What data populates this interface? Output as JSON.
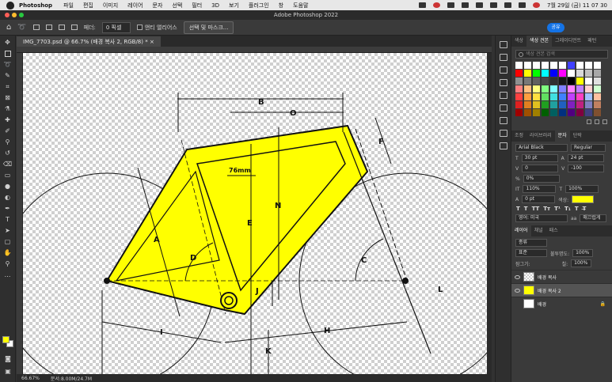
{
  "menubar": {
    "app_name": "Photoshop",
    "items": [
      "파일",
      "편집",
      "이미지",
      "레이어",
      "문자",
      "선택",
      "필터",
      "3D",
      "보기",
      "플러그인",
      "창",
      "도움말"
    ],
    "datetime": "7월 29일 (금) 11 07 30"
  },
  "window": {
    "title": "Adobe Photoshop 2022"
  },
  "options_bar": {
    "feather_label": "페더:",
    "feather_value": "0 픽셀",
    "antialias_label": "앤티 앨리어스",
    "select_mask_label": "선택 및 마스크...",
    "share_label": "공유"
  },
  "document": {
    "tab_title": "IMG_7703.psd @ 66.7% (배경 복사 2, RGB/8) *"
  },
  "status": {
    "zoom": "66.67%",
    "doc_info": "문서:8.00M/24.7M"
  },
  "swatches_panel": {
    "tabs": [
      "색상",
      "색상 견본",
      "그레이디언트",
      "패턴"
    ],
    "active_tab": "색상 견본",
    "search_placeholder": "색상 견본 검색",
    "colors": [
      "#ffffff",
      "#ffffff",
      "#ffffff",
      "#ffffff",
      "#ffffff",
      "#ffffff",
      "#4040ff",
      "#ffffff",
      "#ffffff",
      "#ffffff",
      "#ff0000",
      "#ffff00",
      "#00ff00",
      "#00ffff",
      "#0000ff",
      "#ff00ff",
      "#ffffff",
      "#d8d8d8",
      "#c0c0c0",
      "#a8a8a8",
      "#909090",
      "#787878",
      "#606060",
      "#484848",
      "#303030",
      "#181818",
      "#000000",
      "#ffff00",
      "#ffffff",
      "#e0e0e0",
      "#ff8080",
      "#ffbf80",
      "#ffff80",
      "#80ff80",
      "#80ffff",
      "#8080ff",
      "#ff80ff",
      "#c080ff",
      "#ffd0d0",
      "#d0ffd0",
      "#ff4040",
      "#ff9f40",
      "#ffe040",
      "#60e060",
      "#40e0e0",
      "#4080ff",
      "#c040ff",
      "#ff40c0",
      "#a0c0ff",
      "#ffc0a0",
      "#e02020",
      "#e08020",
      "#e0c020",
      "#20a020",
      "#20a0a0",
      "#2060c0",
      "#8020c0",
      "#c02080",
      "#8080c0",
      "#c08060",
      "#a00000",
      "#a05000",
      "#a08000",
      "#006000",
      "#006060",
      "#003080",
      "#500080",
      "#800040",
      "#404080",
      "#805030"
    ]
  },
  "character_panel": {
    "tabs": [
      "조정",
      "라이브러리",
      "문자",
      "단락"
    ],
    "active_tab": "문자",
    "font_family": "Arial Black",
    "font_style": "Regular",
    "font_size": "30 pt",
    "leading": "24 pt",
    "kerning": "0",
    "tracking": "-100",
    "tsume": "0%",
    "vertical_scale": "110%",
    "horizontal_scale": "100%",
    "baseline_shift": "0 pt",
    "color_label": "색상:",
    "color_value": "#ffff00",
    "style_buttons": [
      "T",
      "T",
      "TT",
      "Tт",
      "T¹",
      "T₁",
      "T",
      "T̶"
    ],
    "language": "영어: 미국",
    "antialias": "aa",
    "antialias_mode": "매끄럽게"
  },
  "layers_panel": {
    "tabs": [
      "레이어",
      "채널",
      "패스"
    ],
    "active_tab": "레이어",
    "filter_label": "종류",
    "blend_mode": "표준",
    "opacity_label": "불투명도:",
    "opacity": "100%",
    "lock_label": "잠그기:",
    "fill_label": "칠:",
    "fill": "100%",
    "layers": [
      {
        "name": "배경 복사",
        "thumb": "transparent",
        "visible": true,
        "selected": false
      },
      {
        "name": "배경 복사 2",
        "thumb": "yellow",
        "visible": true,
        "selected": true
      },
      {
        "name": "배경",
        "thumb": "white",
        "visible": false,
        "selected": false
      }
    ]
  },
  "diagram": {
    "labels": [
      "B",
      "O",
      "F",
      "76mm",
      "N",
      "E",
      "A",
      "D",
      "C",
      "L",
      "J",
      "I",
      "H",
      "K"
    ],
    "fill_color": "#ffff00"
  }
}
